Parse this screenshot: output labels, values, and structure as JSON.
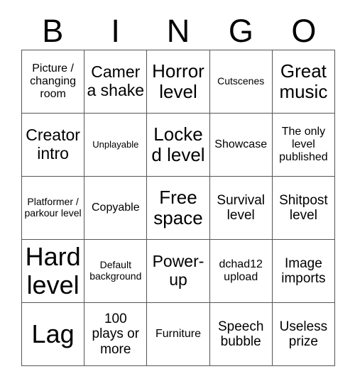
{
  "card": {
    "title_letters": [
      "B",
      "I",
      "N",
      "G",
      "O"
    ],
    "columns": 5,
    "rows": 5,
    "border_color": "#555555",
    "text_color": "#000000",
    "background_color": "#ffffff",
    "cells": [
      {
        "text": "Picture / changing room",
        "size": "sm"
      },
      {
        "text": "Camera shake",
        "size": "lg"
      },
      {
        "text": "Horror level",
        "size": "xl"
      },
      {
        "text": "Cutscenes",
        "size": "xs"
      },
      {
        "text": "Great music",
        "size": "xl"
      },
      {
        "text": "Creator intro",
        "size": "lg"
      },
      {
        "text": "Unplayable",
        "size": "xxs"
      },
      {
        "text": "Locked level",
        "size": "xl"
      },
      {
        "text": "Showcase",
        "size": "sm"
      },
      {
        "text": "The only level published",
        "size": "sm"
      },
      {
        "text": "Platformer / parkour level",
        "size": "xs"
      },
      {
        "text": "Copyable",
        "size": "sm"
      },
      {
        "text": "Free space",
        "size": "xl"
      },
      {
        "text": "Survival level",
        "size": "md"
      },
      {
        "text": "Shitpost level",
        "size": "md"
      },
      {
        "text": "Hard level",
        "size": "xxl"
      },
      {
        "text": "Default background",
        "size": "xs"
      },
      {
        "text": "Power-up",
        "size": "lg"
      },
      {
        "text": "dchad12 upload",
        "size": "sm"
      },
      {
        "text": "Image imports",
        "size": "md"
      },
      {
        "text": "Lag",
        "size": "xxl"
      },
      {
        "text": "100 plays or more",
        "size": "md"
      },
      {
        "text": "Furniture",
        "size": "sm"
      },
      {
        "text": "Speech bubble",
        "size": "md"
      },
      {
        "text": "Useless prize",
        "size": "md"
      }
    ]
  }
}
